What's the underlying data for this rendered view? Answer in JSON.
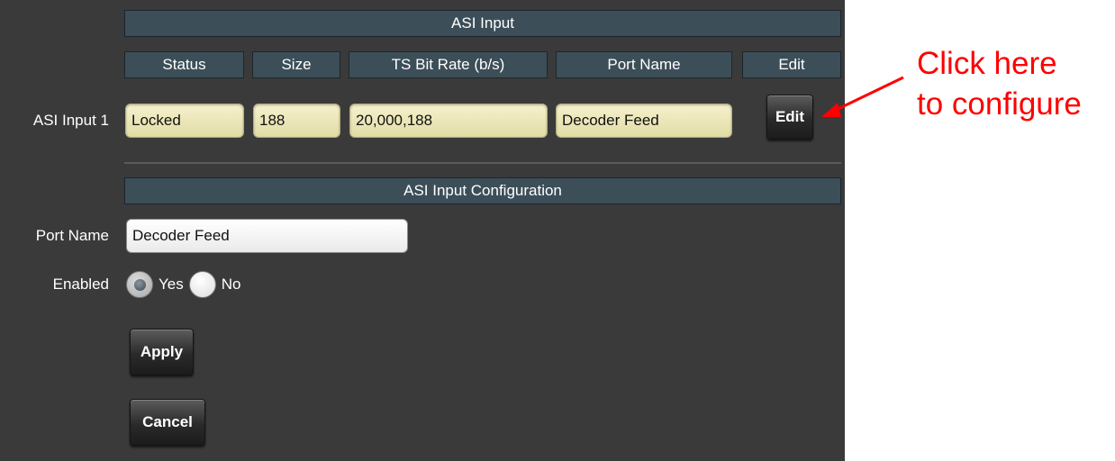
{
  "asi_input": {
    "title": "ASI Input",
    "columns": [
      "Status",
      "Size",
      "TS Bit Rate (b/s)",
      "Port Name",
      "Edit"
    ],
    "row": {
      "label": "ASI Input 1",
      "status": "Locked",
      "size": "188",
      "bit_rate": "20,000,188",
      "port_name": "Decoder Feed",
      "edit_label": "Edit"
    }
  },
  "configuration": {
    "title": "ASI Input Configuration",
    "port_name_label": "Port Name",
    "port_name_value": "Decoder Feed",
    "enabled_label": "Enabled",
    "enabled_options": [
      {
        "label": "Yes",
        "selected": true
      },
      {
        "label": "No",
        "selected": false
      }
    ],
    "apply_label": "Apply",
    "cancel_label": "Cancel"
  },
  "annotation": {
    "line1": "Click here",
    "line2": "to configure",
    "color": "#ff0000"
  },
  "colors": {
    "panel_bg": "#3a3a3a",
    "header_bg": "#3c4e58",
    "status_field_bg": "#f0ecc2"
  }
}
